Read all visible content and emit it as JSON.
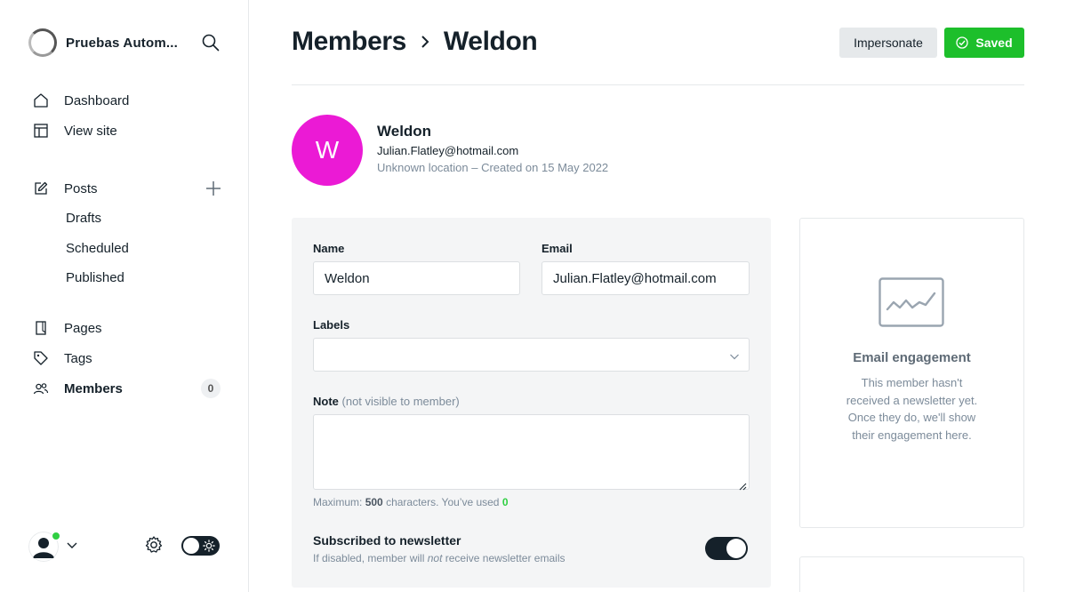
{
  "sidebar": {
    "brand_name": "Pruebas Autom...",
    "nav_primary": [
      {
        "label": "Dashboard",
        "icon": "home-icon"
      },
      {
        "label": "View site",
        "icon": "layout-icon"
      }
    ],
    "posts": {
      "label": "Posts",
      "icon": "edit-icon"
    },
    "posts_sub": [
      {
        "label": "Drafts"
      },
      {
        "label": "Scheduled"
      },
      {
        "label": "Published"
      }
    ],
    "nav_secondary": [
      {
        "label": "Pages",
        "icon": "page-icon"
      },
      {
        "label": "Tags",
        "icon": "tag-icon"
      }
    ],
    "members": {
      "label": "Members",
      "icon": "members-icon",
      "count": "0"
    }
  },
  "header": {
    "breadcrumb_parent": "Members",
    "breadcrumb_current": "Weldon",
    "impersonate_label": "Impersonate",
    "saved_label": "Saved"
  },
  "member": {
    "initial": "W",
    "name": "Weldon",
    "email": "Julian.Flatley@hotmail.com",
    "meta": "Unknown location – Created on 15 May 2022",
    "avatar_color": "#eb1ad5"
  },
  "form": {
    "name_label": "Name",
    "name_value": "Weldon",
    "email_label": "Email",
    "email_value": "Julian.Flatley@hotmail.com",
    "labels_label": "Labels",
    "labels_value": "",
    "note_label": "Note",
    "note_hint": "(not visible to member)",
    "note_value": "",
    "char_prefix": "Maximum:",
    "char_max": "500",
    "char_mid": "characters. You’ve used",
    "char_used": "0",
    "newsletter_title": "Subscribed to newsletter",
    "newsletter_sub_1": "If disabled, member will",
    "newsletter_sub_em": "not",
    "newsletter_sub_2": "receive newsletter emails",
    "newsletter_enabled": true
  },
  "engagement": {
    "title": "Email engagement",
    "text": "This member hasn't received a newsletter yet. Once they do, we'll show their engagement here."
  },
  "colors": {
    "accent_green": "#30cf43",
    "dark": "#15212a"
  }
}
